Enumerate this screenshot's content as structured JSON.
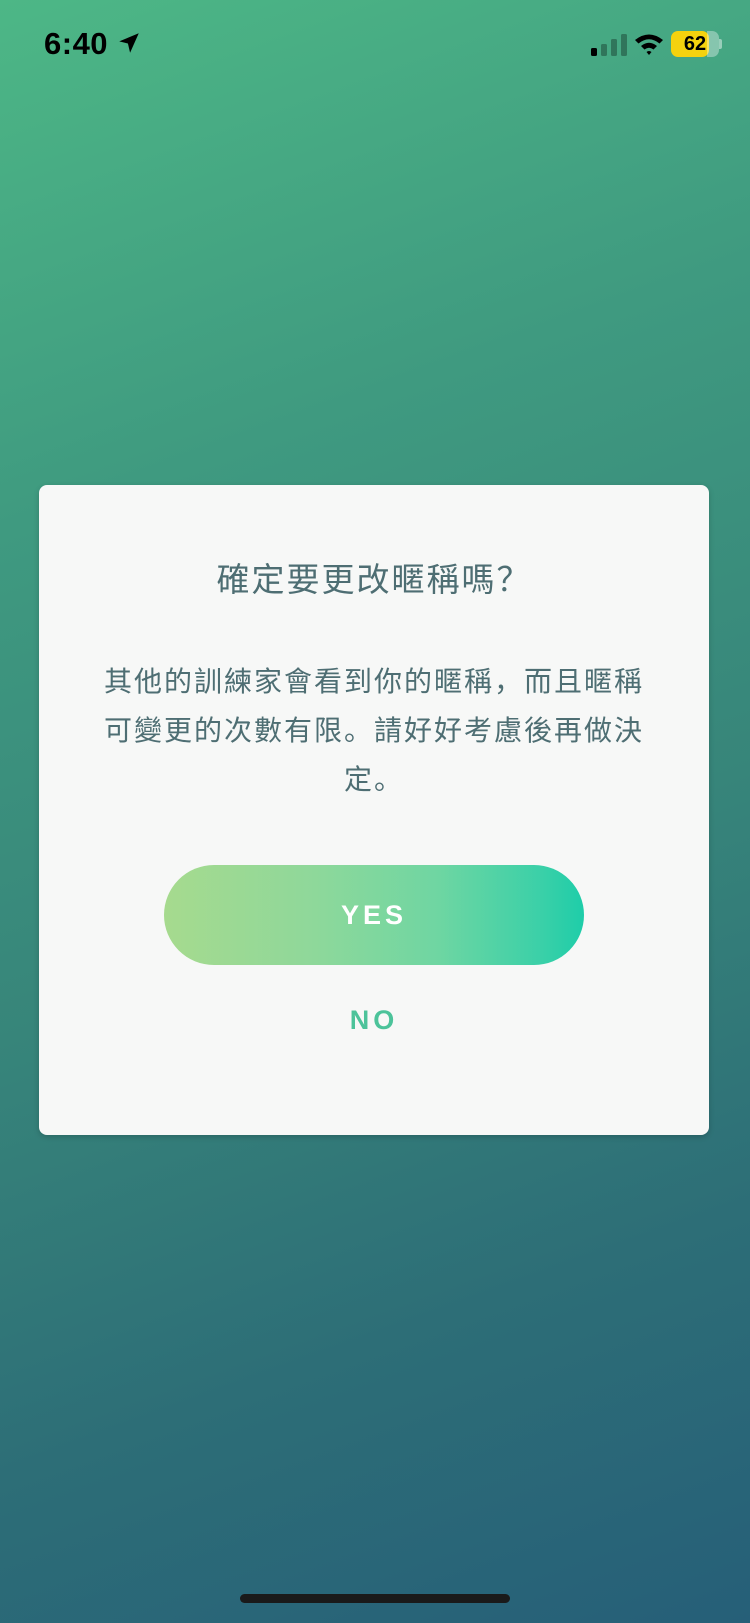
{
  "status_bar": {
    "time": "6:40",
    "battery_percent": "62",
    "icons": [
      "location-arrow-icon",
      "cellular-signal-icon",
      "wifi-icon",
      "battery-icon"
    ]
  },
  "dialog": {
    "title": "確定要更改暱稱嗎？",
    "message": "其他的訓練家會看到你的暱稱，而且暱稱可變更的次數有限。請好好考慮後再做決定。",
    "yes_label": "YES",
    "no_label": "NO"
  },
  "colors": {
    "background_top": "#4db786",
    "background_bottom": "#265f78",
    "dialog_background": "#f7f8f7",
    "text": "#4e6e73",
    "yes_gradient_start": "#a6da8e",
    "yes_gradient_end": "#1ecda9",
    "no_text": "#4cc39a",
    "battery": "#f5d20e"
  }
}
